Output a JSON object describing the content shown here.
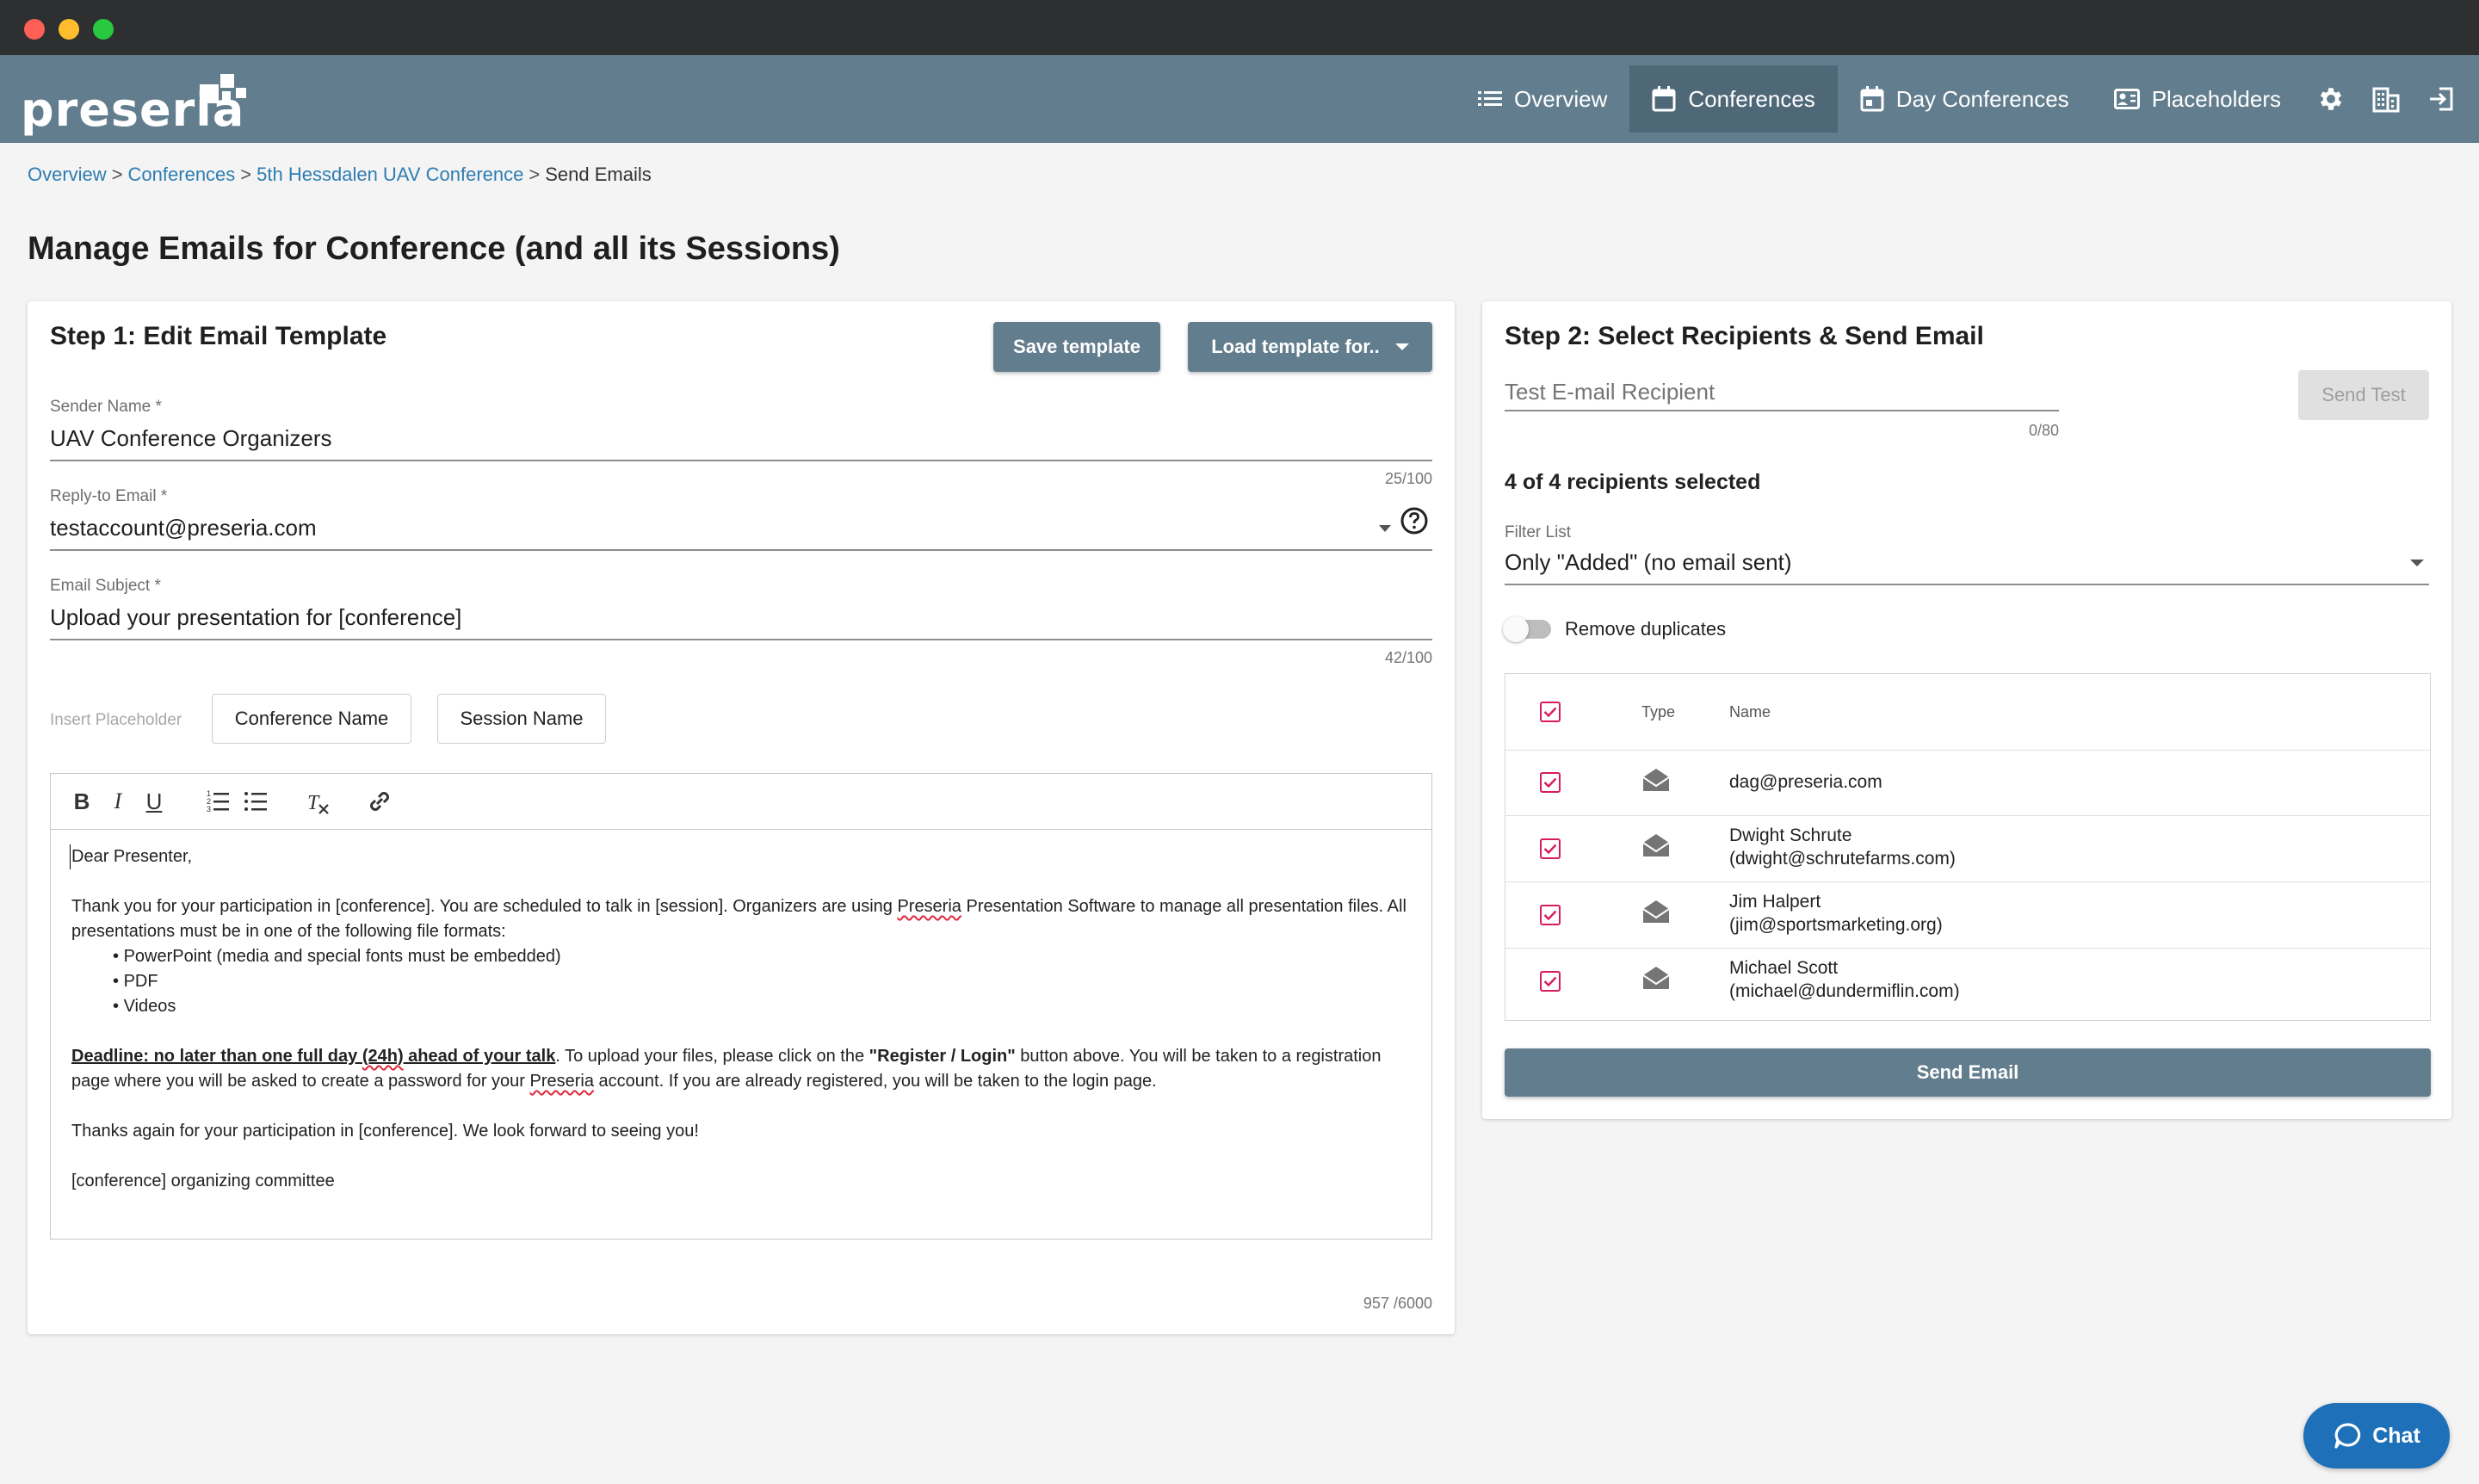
{
  "app": {
    "logo_text": "preseria"
  },
  "nav": {
    "items": [
      {
        "label": "Overview",
        "icon": "list-icon"
      },
      {
        "label": "Conferences",
        "icon": "calendar-icon",
        "active": true
      },
      {
        "label": "Day Conferences",
        "icon": "calendar-day-icon"
      },
      {
        "label": "Placeholders",
        "icon": "id-card-icon"
      }
    ],
    "icons": [
      "gear-icon",
      "building-icon",
      "logout-icon"
    ]
  },
  "breadcrumb": {
    "items": [
      "Overview",
      "Conferences",
      "5th Hessdalen UAV Conference"
    ],
    "current": "Send Emails",
    "separator": ">"
  },
  "page_title": "Manage Emails for Conference (and all its Sessions)",
  "step1": {
    "title": "Step 1: Edit Email Template",
    "save_template": "Save template",
    "load_template": "Load template for..",
    "sender_name": {
      "label": "Sender Name *",
      "value": "UAV Conference Organizers",
      "counter": "25/100"
    },
    "reply_to": {
      "label": "Reply-to Email *",
      "value": "testaccount@preseria.com"
    },
    "subject": {
      "label": "Email Subject *",
      "value": "Upload your presentation for [conference]",
      "counter": "42/100"
    },
    "insert_placeholder_label": "Insert Placeholder",
    "placeholders": [
      "Conference Name",
      "Session Name"
    ],
    "toolbar": [
      "bold-icon",
      "italic-icon",
      "underline-icon",
      "ordered-list-icon",
      "bullet-list-icon",
      "clear-format-icon",
      "link-icon"
    ],
    "body": {
      "greeting": "Dear Presenter,",
      "intro_a": "Thank you for your participation in [conference]. You are scheduled to talk in [session]. Organizers are using ",
      "intro_brand": "Preseria",
      "intro_b": " Presentation Software to manage all presentation files. All presentations must be in one of the following file formats:",
      "formats": [
        "PowerPoint (media and special fonts must be embedded)",
        "PDF",
        "Videos"
      ],
      "deadline_a": "Deadline: no later than one full day ",
      "deadline_b": "(24h)",
      "deadline_c": " ahead of your talk",
      "deadline_rest_a": ". To upload your files, please click on the ",
      "deadline_button": "\"Register / Login\"",
      "deadline_rest_b": " button above. You will be taken to a registration page where you will be asked to create a password for your ",
      "deadline_brand": "Preseria",
      "deadline_rest_c": " account. If you are already registered, you will be taken to the login page.",
      "thanks": "Thanks again for your participation in [conference]. We look forward to seeing you!",
      "signoff": "[conference] organizing committee"
    },
    "body_counter": "957 /6000"
  },
  "step2": {
    "title": "Step 2: Select Recipients & Send Email",
    "test_recipient_placeholder": "Test E-mail Recipient",
    "test_counter": "0/80",
    "send_test": "Send Test",
    "selected_summary": "4 of 4 recipients selected",
    "filter_label": "Filter List",
    "filter_value": "Only \"Added\" (no email sent)",
    "remove_duplicates": "Remove duplicates",
    "table": {
      "headers": {
        "type": "Type",
        "name": "Name"
      },
      "rows": [
        {
          "line1": "dag@preseria.com",
          "line2": ""
        },
        {
          "line1": "Dwight Schrute",
          "line2": "(dwight@schrutefarms.com)"
        },
        {
          "line1": "Jim Halpert",
          "line2": "(jim@sportsmarketing.org)"
        },
        {
          "line1": "Michael Scott",
          "line2": "(michael@dundermiflin.com)"
        }
      ]
    },
    "send_email": "Send Email"
  },
  "chat": {
    "label": "Chat"
  },
  "colors": {
    "header": "#627d8d",
    "accent": "#d81b60",
    "link": "#2e7db2",
    "chat": "#1e70b8"
  }
}
